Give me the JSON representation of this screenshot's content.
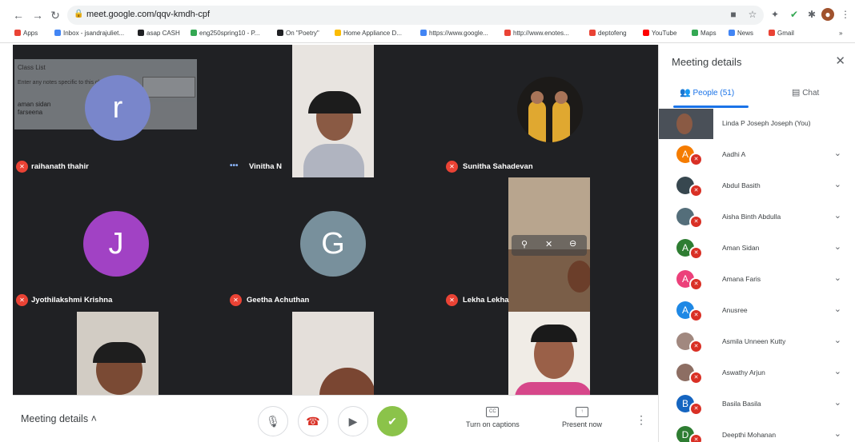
{
  "browser": {
    "url": "meet.google.com/qqv-kmdh-cpf",
    "bookmarks": [
      {
        "label": "Apps",
        "color": "#ea4335"
      },
      {
        "label": "Inbox - jsandrajuliet...",
        "color": "#4285f4"
      },
      {
        "label": "asap CASH",
        "color": "#202124"
      },
      {
        "label": "eng250spring10 - P...",
        "color": "#34a853"
      },
      {
        "label": "On \"Poetry\"",
        "color": "#202124"
      },
      {
        "label": "Home Appliance D...",
        "color": "#fbbc04"
      },
      {
        "label": "https://www.google...",
        "color": "#4285f4"
      },
      {
        "label": "http://www.enotes...",
        "color": "#ea4335"
      },
      {
        "label": "deptofeng",
        "color": "#ea4335"
      },
      {
        "label": "YouTube",
        "color": "#ff0000"
      },
      {
        "label": "Maps",
        "color": "#34a853"
      },
      {
        "label": "News",
        "color": "#4285f4"
      },
      {
        "label": "Gmail",
        "color": "#ea4335"
      }
    ]
  },
  "overlay": {
    "title": "Class List",
    "placeholder": "Enter any notes specific to this class",
    "names": [
      "aman sidan",
      "farseena"
    ]
  },
  "tiles": [
    {
      "name": "raihanath thahir",
      "avatar_letter": "r",
      "avatar_color": "#7986cb",
      "muted": true
    },
    {
      "name": "Vinitha N",
      "muted": false
    },
    {
      "name": "Sunitha Sahadevan",
      "muted": true
    },
    {
      "name": "Jyothilakshmi Krishna",
      "avatar_letter": "J",
      "avatar_color": "#a142c4",
      "muted": true
    },
    {
      "name": "Geetha Achuthan",
      "avatar_letter": "G",
      "avatar_color": "#78909c",
      "muted": true
    },
    {
      "name": "Lekha Lekha",
      "muted": true
    },
    {
      "name": "",
      "muted": false
    },
    {
      "name": "",
      "muted": false
    },
    {
      "name": "",
      "muted": false
    }
  ],
  "toolbar": {
    "meeting_details": "Meeting details",
    "captions_label": "Turn on captions",
    "present_label": "Present now"
  },
  "side_panel": {
    "title": "Meeting details",
    "people_tab": "People (51)",
    "chat_tab": "Chat",
    "people": [
      {
        "name": "Linda P Joseph Joseph (You)",
        "photo": true,
        "color": "#4a5058",
        "letter": ""
      },
      {
        "name": "Aadhi A",
        "color": "#f57c00",
        "letter": "A"
      },
      {
        "name": "Abdul Basith",
        "color": "#37474f",
        "letter": ""
      },
      {
        "name": "Aisha Binth Abdulla",
        "color": "#546e7a",
        "letter": ""
      },
      {
        "name": "Aman Sidan",
        "color": "#2e7d32",
        "letter": "A"
      },
      {
        "name": "Amana Faris",
        "color": "#ec407a",
        "letter": "A"
      },
      {
        "name": "Anusree",
        "color": "#1e88e5",
        "letter": "A"
      },
      {
        "name": "Asmila Unneen Kutty",
        "color": "#a1887f",
        "letter": ""
      },
      {
        "name": "Aswathy Arjun",
        "color": "#8d6e63",
        "letter": ""
      },
      {
        "name": "Basila Basila",
        "color": "#1565c0",
        "letter": "B"
      },
      {
        "name": "Deepthi Mohanan",
        "color": "#2e7d32",
        "letter": "D"
      }
    ]
  }
}
